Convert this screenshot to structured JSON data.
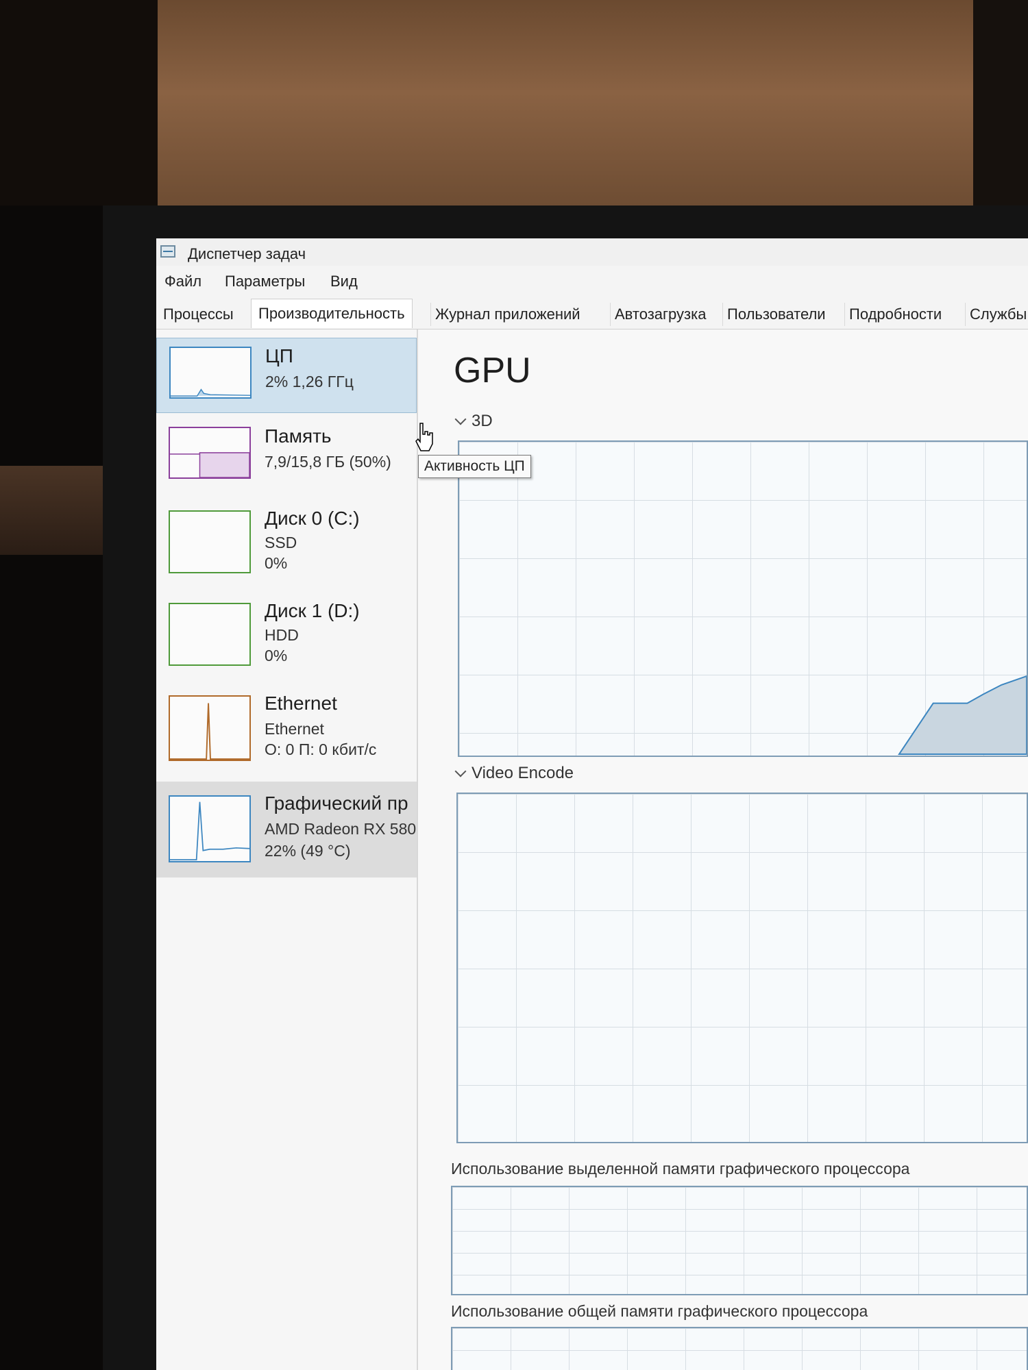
{
  "window": {
    "title": "Диспетчер задач"
  },
  "menu": {
    "items": [
      "Файл",
      "Параметры",
      "Вид"
    ]
  },
  "tabs": [
    "Процессы",
    "Производительность",
    "Журнал приложений",
    "Автозагрузка",
    "Пользователи",
    "Подробности",
    "Службы"
  ],
  "active_tab": "Производительность",
  "resources": [
    {
      "name": "ЦП",
      "line1": "2% 1,26 ГГц",
      "line2": "",
      "state": "selected"
    },
    {
      "name": "Память",
      "line1": "7,9/15,8 ГБ (50%)",
      "line2": ""
    },
    {
      "name": "Диск 0 (C:)",
      "line1": "SSD",
      "line2": "0%"
    },
    {
      "name": "Диск 1 (D:)",
      "line1": "HDD",
      "line2": "0%"
    },
    {
      "name": "Ethernet",
      "line1": "Ethernet",
      "line2": "О: 0 П: 0 кбит/с"
    },
    {
      "name": "Графический пр",
      "line1": "AMD Radeon RX 580",
      "line2": "22% (49 °C)",
      "state": "hovered"
    }
  ],
  "tooltip": "Активность ЦП",
  "main": {
    "title": "GPU",
    "sections": [
      {
        "label": "3D"
      },
      {
        "label": "Video Encode"
      },
      {
        "label": "Использование выделенной памяти графического процессора"
      },
      {
        "label": "Использование общей памяти графического процессора"
      }
    ]
  },
  "colors": {
    "selected_bg": "#cfe1ee",
    "graph_border": "#7e9cb5",
    "graph_fill": "#c9d6e0"
  }
}
